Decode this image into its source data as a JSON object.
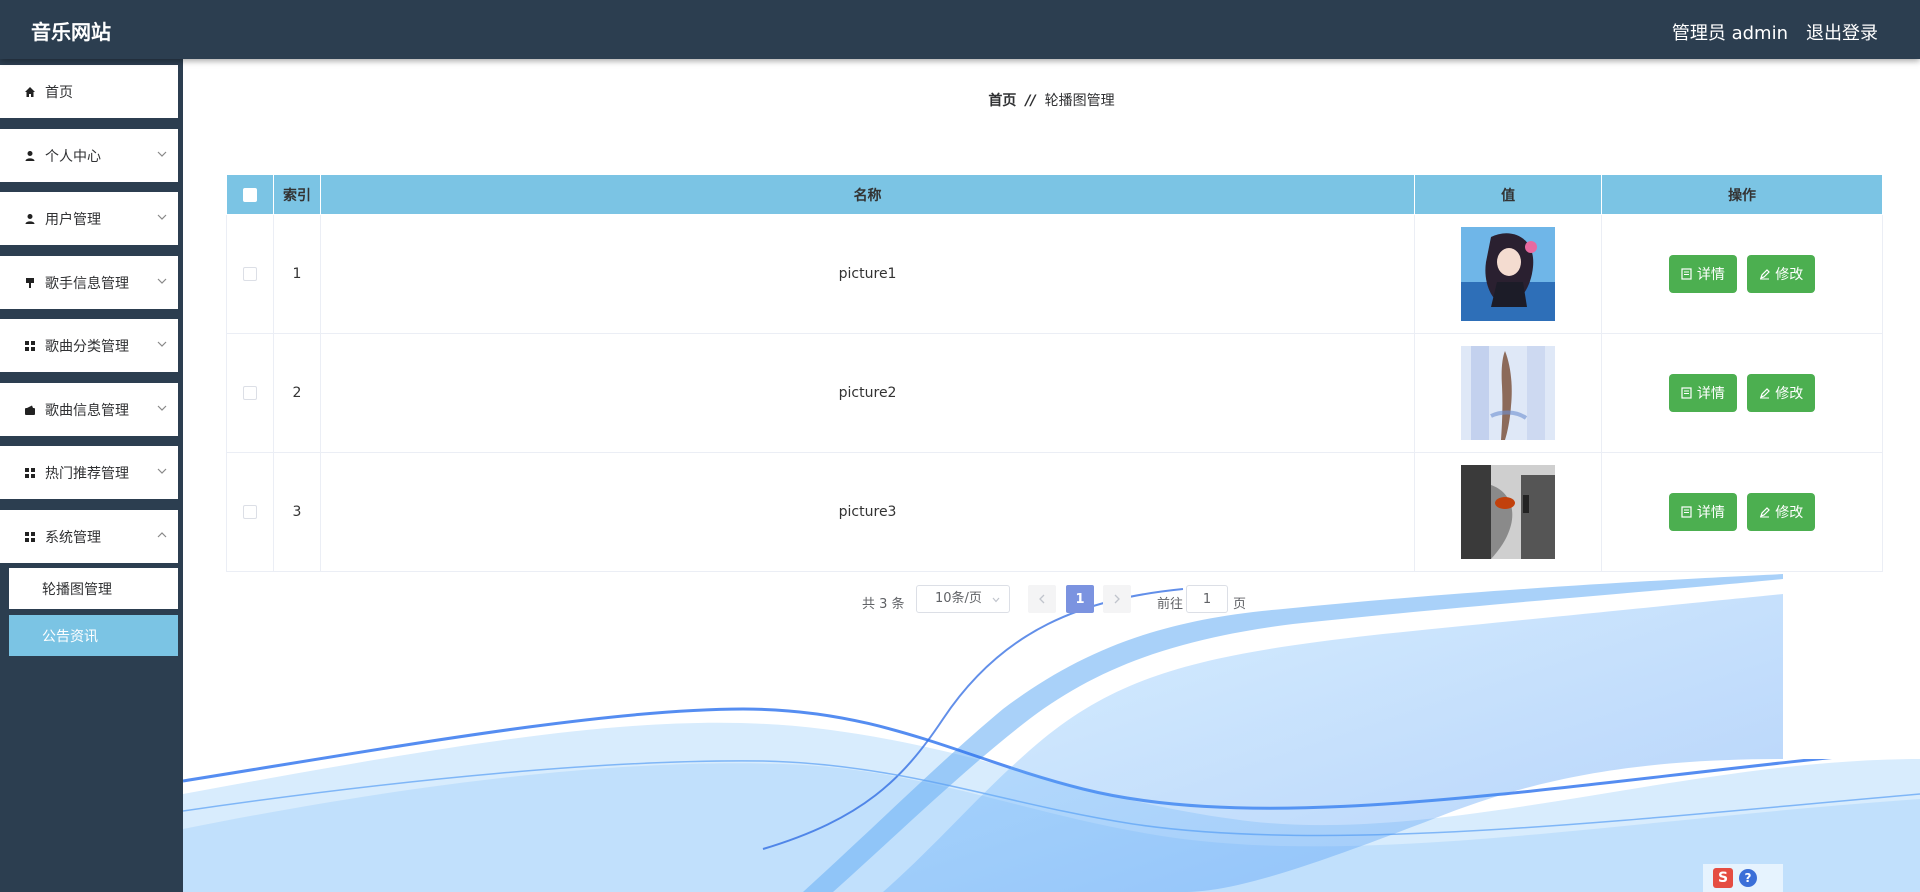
{
  "header": {
    "site_title": "音乐网站",
    "admin_label": "管理员 admin",
    "logout_label": "退出登录"
  },
  "sidebar": {
    "items": [
      {
        "label": "首页",
        "icon": "home-icon",
        "expandable": false
      },
      {
        "label": "个人中心",
        "icon": "user-icon",
        "expandable": true
      },
      {
        "label": "用户管理",
        "icon": "user-icon",
        "expandable": true
      },
      {
        "label": "歌手信息管理",
        "icon": "pin-icon",
        "expandable": true
      },
      {
        "label": "歌曲分类管理",
        "icon": "grid-icon",
        "expandable": true
      },
      {
        "label": "歌曲信息管理",
        "icon": "wallet-icon",
        "expandable": true
      },
      {
        "label": "热门推荐管理",
        "icon": "grid-icon",
        "expandable": true
      },
      {
        "label": "系统管理",
        "icon": "grid-icon",
        "expandable": true
      }
    ],
    "sub_items": [
      {
        "label": "轮播图管理",
        "active": false
      },
      {
        "label": "公告资讯",
        "active": true
      }
    ]
  },
  "breadcrumb": {
    "home": "首页",
    "separator": "//",
    "current": "轮播图管理"
  },
  "table": {
    "headers": [
      "索引",
      "名称",
      "值",
      "操作"
    ],
    "rows": [
      {
        "index": "1",
        "name": "picture1",
        "image": "anime-girl-thumbnail"
      },
      {
        "index": "2",
        "name": "picture2",
        "image": "blurred-figure-thumbnail"
      },
      {
        "index": "3",
        "name": "picture3",
        "image": "dark-photo-thumbnail"
      }
    ],
    "detail_label": "详情",
    "edit_label": "修改"
  },
  "pagination": {
    "total": "共 3 条",
    "page_size": "10条/页",
    "current_page": "1",
    "goto_label": "前往",
    "goto_value": "1",
    "page_suffix": "页"
  },
  "colors": {
    "header_bg": "#2c3e50",
    "table_header_bg": "#7bc4e4",
    "action_button": "#4caf50",
    "pager_active": "#7b93e0"
  }
}
